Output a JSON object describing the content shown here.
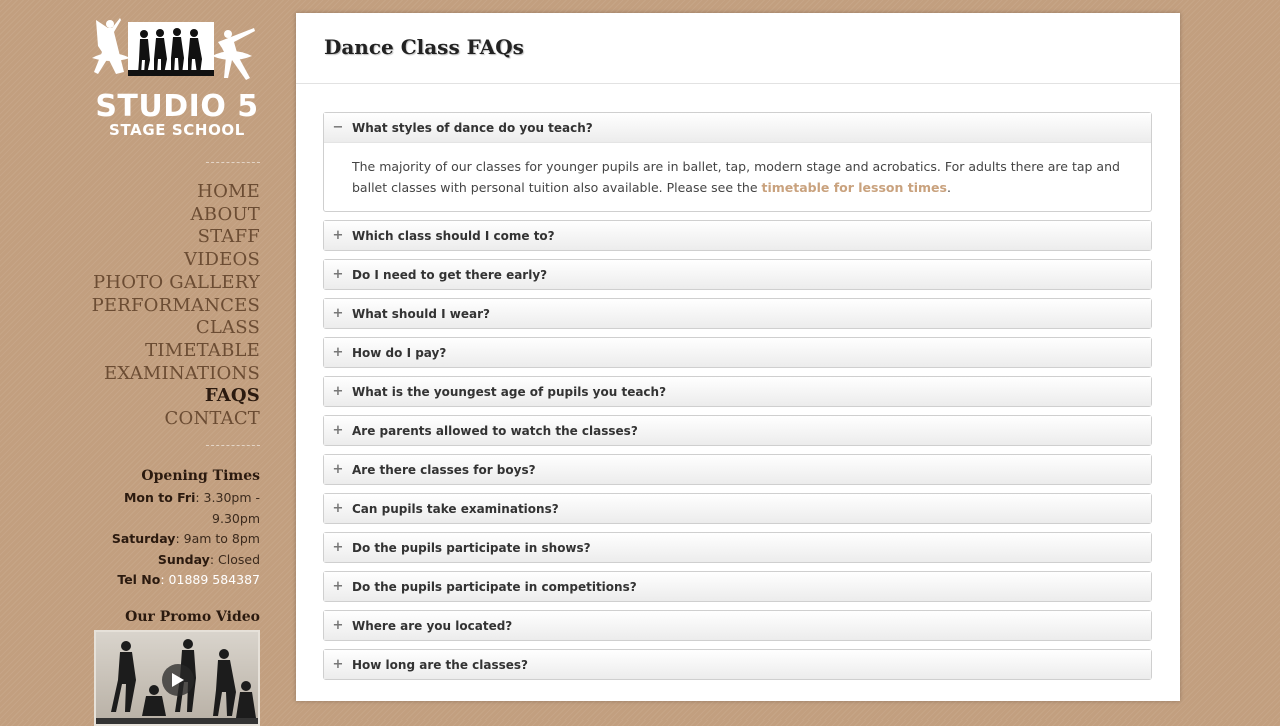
{
  "logo": {
    "line1": "STUDIO 5",
    "line2": "STAGE SCHOOL"
  },
  "nav": [
    "HOME",
    "ABOUT",
    "STAFF",
    "VIDEOS",
    "PHOTO GALLERY",
    "PERFORMANCES",
    "CLASS TIMETABLE",
    "EXAMINATIONS",
    "FAQS",
    "CONTACT"
  ],
  "opening": {
    "title": "Opening Times",
    "weekdays_label": "Mon to Fri",
    "weekdays_value": ": 3.30pm - 9.30pm",
    "saturday_label": "Saturday",
    "saturday_value": ": 9am to 8pm",
    "sunday_label": "Sunday",
    "sunday_value": ": Closed",
    "tel_label": "Tel No",
    "tel_value": ": 01889 584387"
  },
  "promo": {
    "title": "Our Promo Video"
  },
  "page": {
    "title": "Dance Class FAQs"
  },
  "faq": {
    "open": {
      "question": "What styles of dance do you teach?",
      "answer_before": "The majority of our classes for younger pupils are in ballet, tap, modern stage and acrobatics. For adults there are tap and ballet classes with personal tuition also available. Please see the ",
      "answer_link": "timetable for lesson times",
      "answer_after": "."
    },
    "closed": [
      "Which class should I come to?",
      "Do I need to get there early?",
      "What should I wear?",
      "How do I pay?",
      "What is the youngest age of pupils you teach?",
      "Are parents allowed to watch the classes?",
      "Are there classes for boys?",
      "Can pupils take examinations?",
      "Do the pupils participate in shows?",
      "Do the pupils participate in competitions?",
      "Where are you located?",
      "How long are the classes?"
    ],
    "open_sign": "−",
    "closed_sign": "+"
  },
  "colors": {
    "background": "#c29f7f",
    "link": "#c9a27e",
    "active_nav": "#2b1a0f"
  }
}
